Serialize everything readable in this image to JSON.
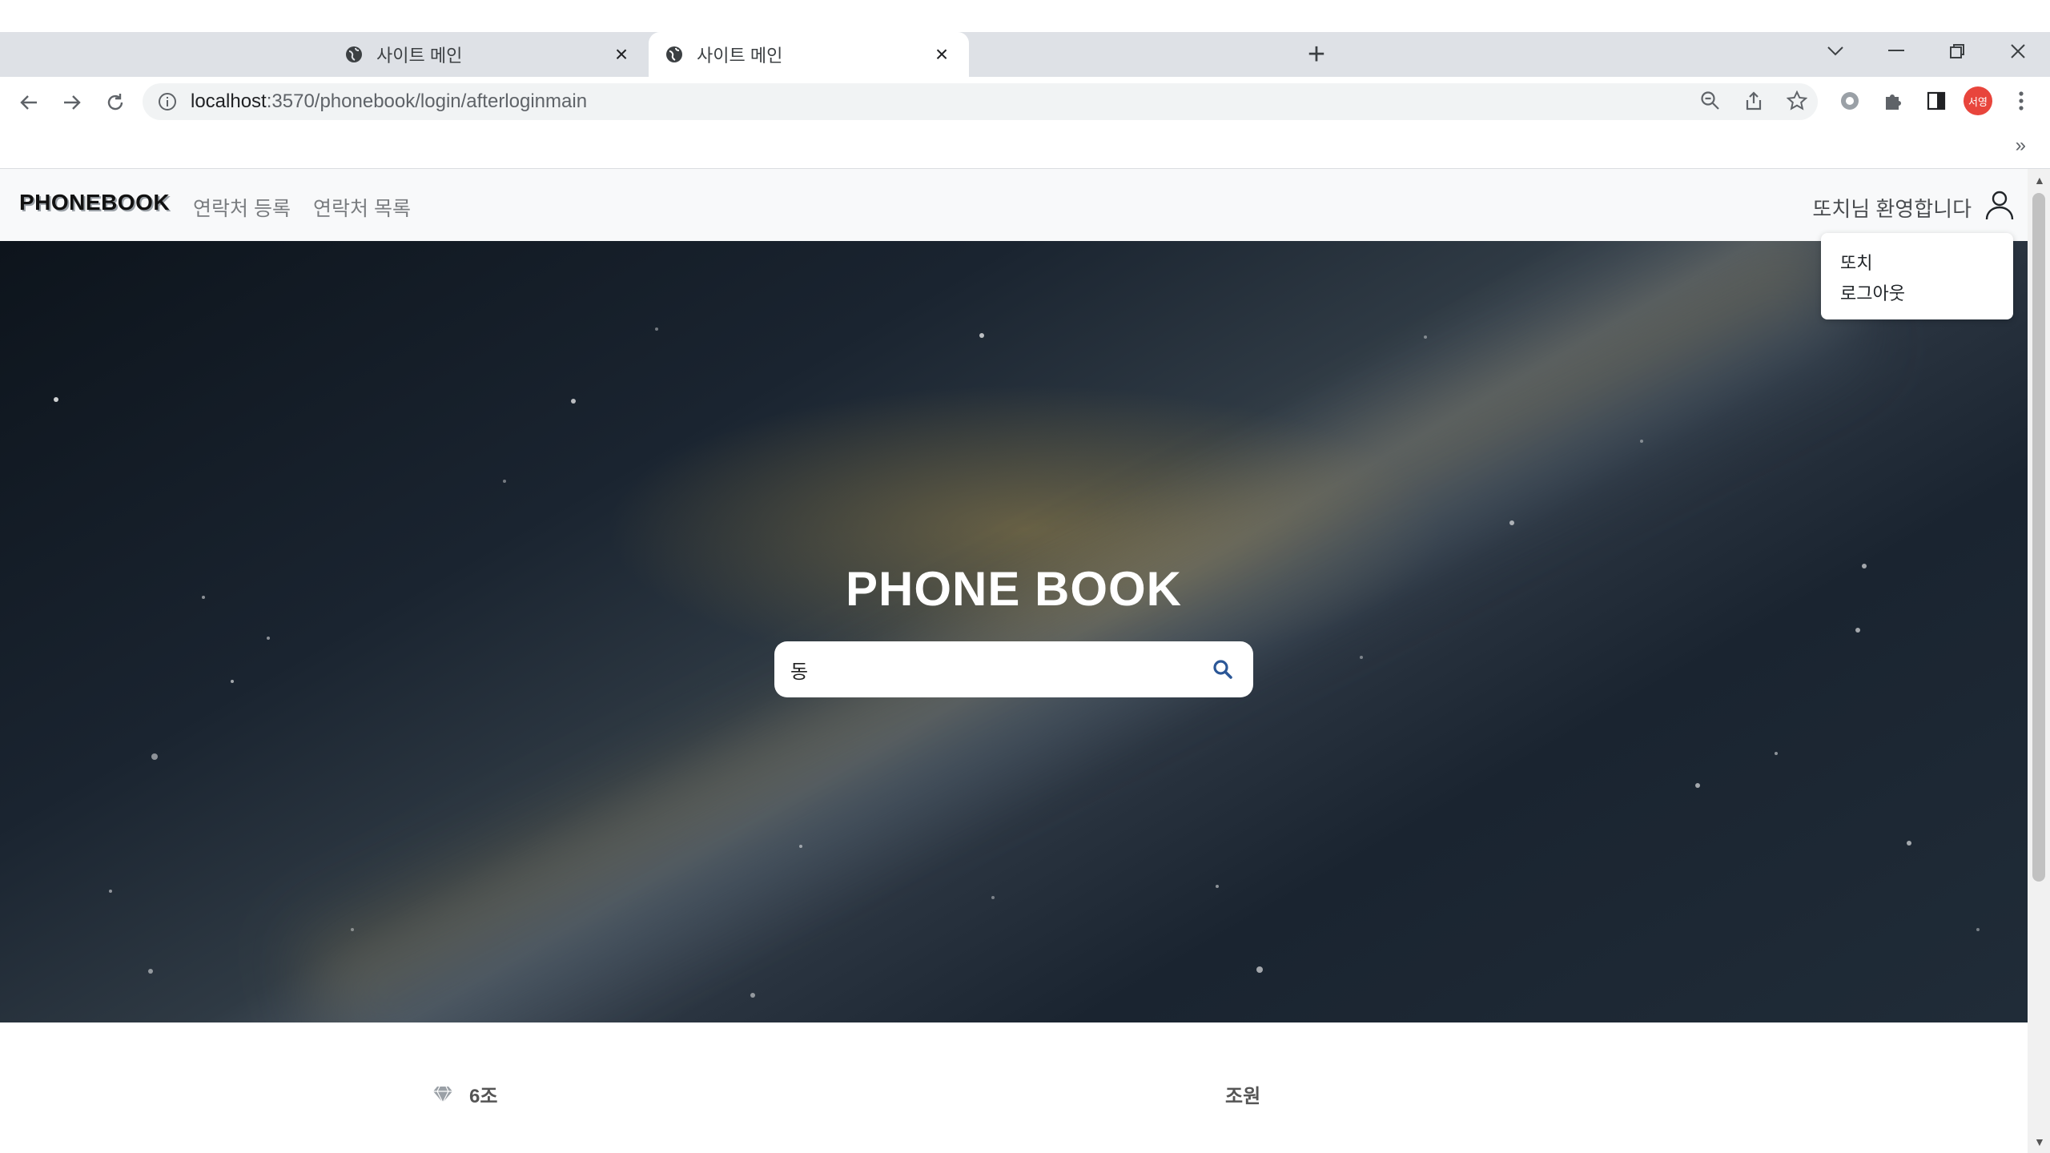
{
  "browser": {
    "tabs": [
      {
        "title": "사이트 메인",
        "active": false
      },
      {
        "title": "사이트 메인",
        "active": true
      }
    ],
    "new_tab": "+",
    "url": {
      "host": "localhost",
      "path": ":3570/phonebook/login/afterloginmain"
    },
    "profile_label": "서영",
    "bookmarks_overflow": "»"
  },
  "navbar": {
    "brand": "PHONEBOOK",
    "links": [
      "연락처 등록",
      "연락처 목록"
    ],
    "welcome": "또치님 환영합니다"
  },
  "user_menu": {
    "items": [
      "또치",
      "로그아웃"
    ]
  },
  "hero": {
    "title": "PHONE BOOK",
    "search_value": "동"
  },
  "footer": {
    "team": "6조",
    "members_label": "조원"
  },
  "colors": {
    "search_icon": "#2b5797",
    "profile": "#e8453c"
  }
}
